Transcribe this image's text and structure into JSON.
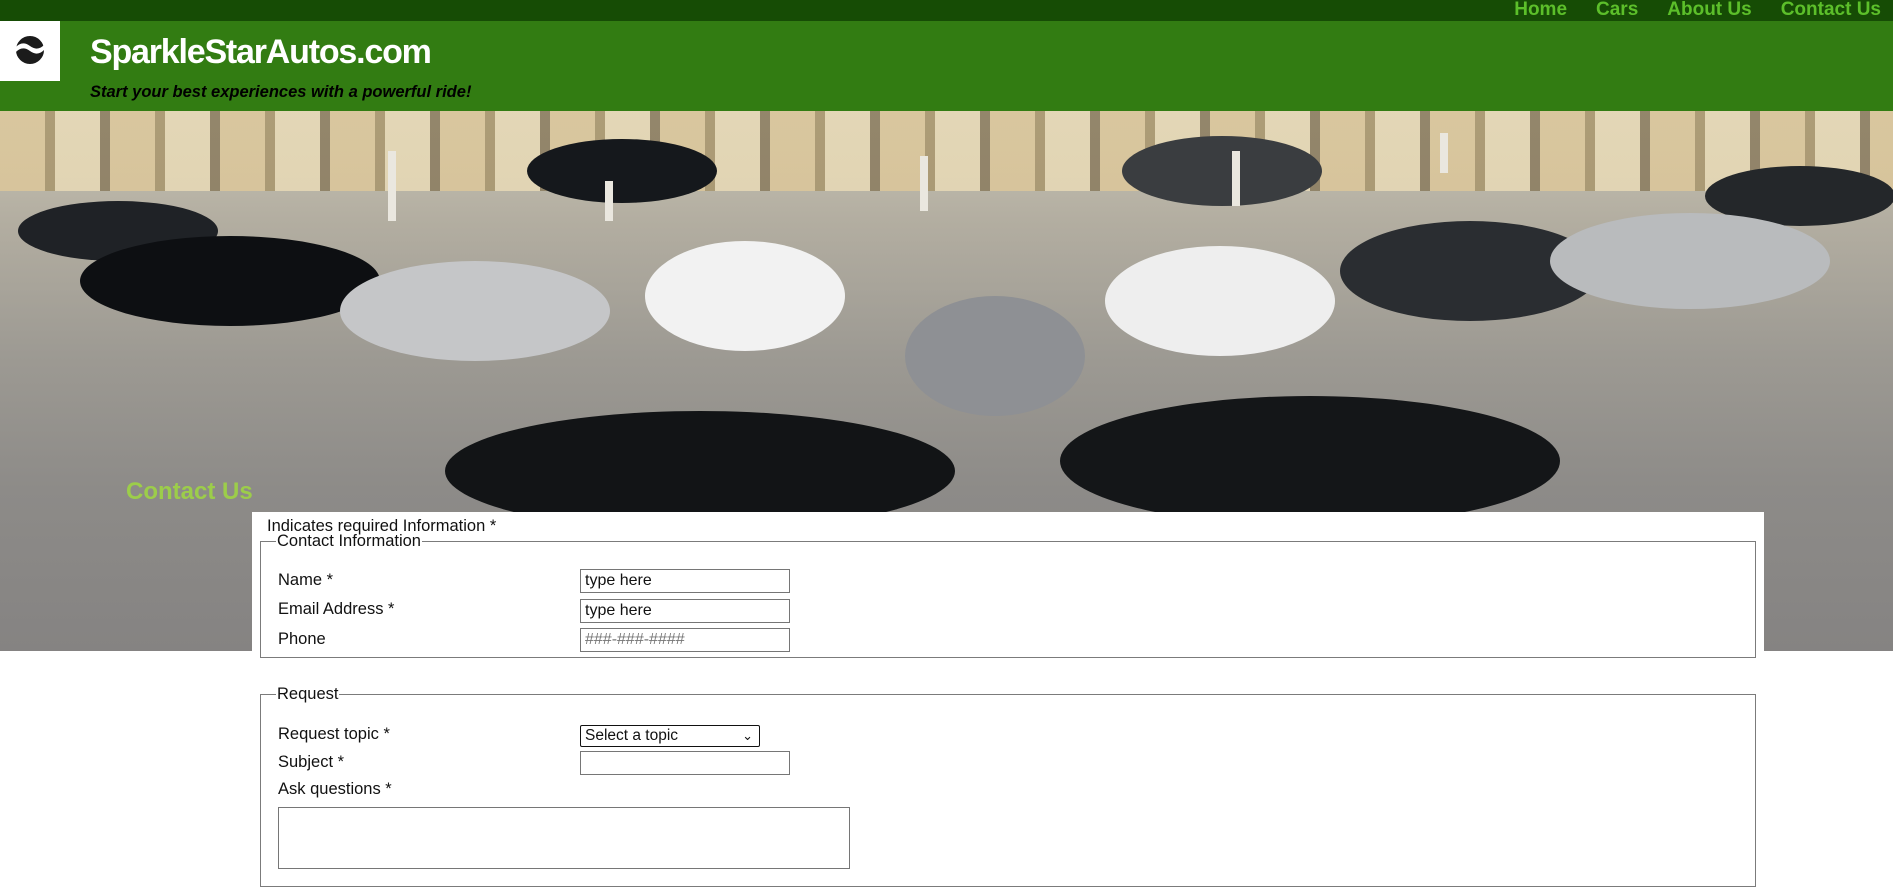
{
  "nav": {
    "items": [
      "Home",
      "Cars",
      "About Us",
      "Contact Us"
    ]
  },
  "header": {
    "title": "SparkleStarAutos.com",
    "tagline": "Start your best experiences with a powerful ride!",
    "logo_icon": "wave-logo-icon"
  },
  "hero": {
    "heading": "Contact Us"
  },
  "form": {
    "required_note": "Indicates required Information *",
    "contact_info": {
      "legend": "Contact Information",
      "name_label": "Name *",
      "name_value": "type here",
      "email_label": "Email Address *",
      "email_value": "type here",
      "phone_label": "Phone",
      "phone_placeholder": "###-###-####"
    },
    "request": {
      "legend": "Request",
      "topic_label": "Request topic *",
      "topic_selected": "Select a topic",
      "subject_label": "Subject *",
      "questions_label": "Ask questions *"
    }
  },
  "colors": {
    "topbar": "#164c05",
    "header": "#327c12",
    "nav_link": "#5cbf2a",
    "heading_green": "#9ccd4a"
  }
}
